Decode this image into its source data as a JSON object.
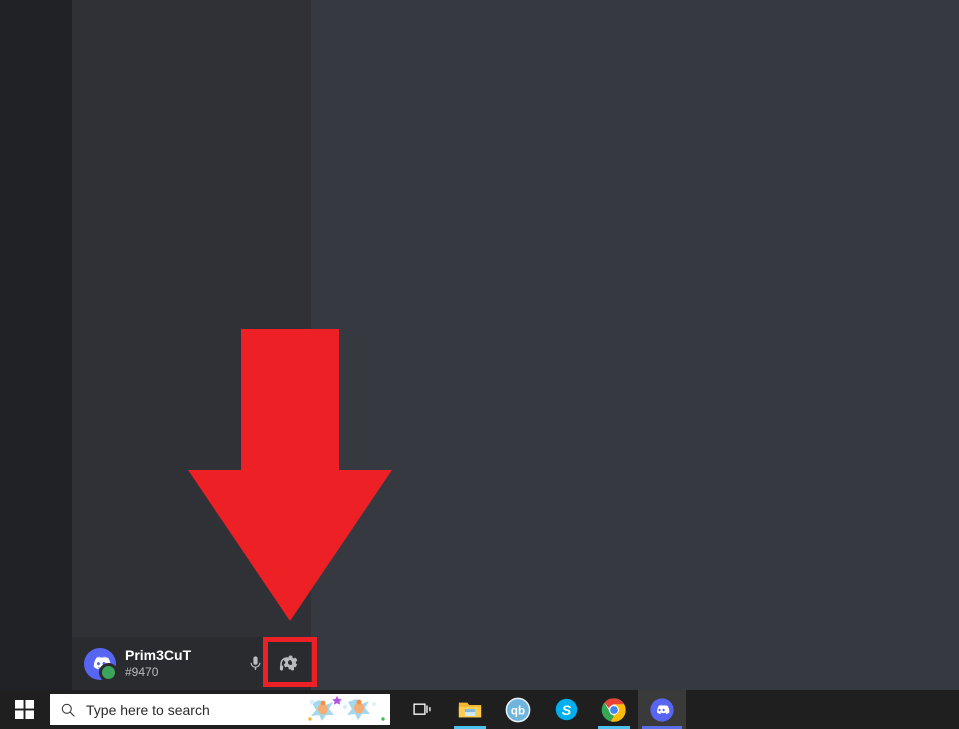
{
  "app": {
    "name": "Discord",
    "window_background": "#36393f",
    "server_rail_color": "#202225",
    "sidebar_color": "#2f3136",
    "user_panel_color": "#292b2f"
  },
  "user_panel": {
    "username": "Prim3CuT",
    "discriminator": "#9470",
    "status": "online",
    "status_color": "#3ba55d",
    "avatar_icon": "discord-logo-avatar",
    "buttons": [
      {
        "name": "mute-microphone-button",
        "icon": "microphone-icon"
      },
      {
        "name": "deafen-button",
        "icon": "headphones-icon"
      },
      {
        "name": "user-settings-button",
        "icon": "gear-icon"
      }
    ]
  },
  "annotation": {
    "arrow_color": "#ed2026",
    "arrow_direction": "down",
    "highlight_color": "#ed2026",
    "highlight_target": "user-settings-button"
  },
  "taskbar": {
    "background": "#1f1f1f",
    "start_label": "Start",
    "start_icon": "windows-logo-icon",
    "search": {
      "placeholder": "Type here to search",
      "icon": "search-icon",
      "decoration": "bing-daily-illustration"
    },
    "items": [
      {
        "name": "task-view-button",
        "icon": "task-view-icon",
        "label": "Task View",
        "running": false,
        "active": false
      },
      {
        "name": "file-explorer-button",
        "icon": "file-explorer-icon",
        "label": "File Explorer",
        "running": true,
        "active": false
      },
      {
        "name": "qbittorrent-button",
        "icon": "qbittorrent-icon",
        "label": "qBittorrent",
        "running": false,
        "active": false
      },
      {
        "name": "skype-button",
        "icon": "skype-icon",
        "label": "Skype",
        "running": false,
        "active": false
      },
      {
        "name": "chrome-button",
        "icon": "chrome-icon",
        "label": "Google Chrome",
        "running": true,
        "active": false
      },
      {
        "name": "discord-button",
        "icon": "discord-icon",
        "label": "Discord",
        "running": true,
        "active": true
      }
    ]
  }
}
